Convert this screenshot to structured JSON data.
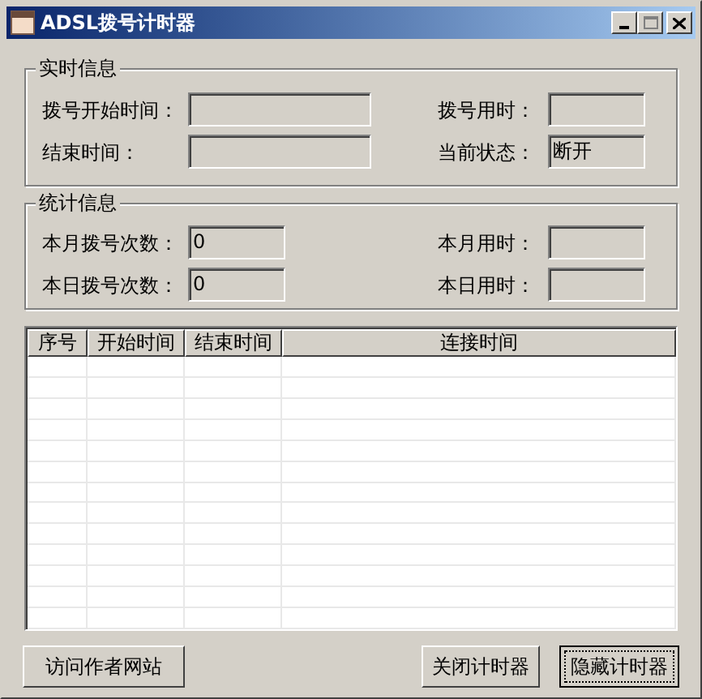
{
  "window": {
    "title": "ADSL拨号计时器"
  },
  "realtime": {
    "title": "实时信息",
    "rows": [
      {
        "left": {
          "label": "拨号开始时间："
        },
        "right": {
          "label": "拨号用时："
        }
      },
      {
        "left": {
          "label": "结束时间："
        },
        "right": {
          "label": "当前状态：",
          "value": "断开"
        }
      }
    ]
  },
  "stats": {
    "title": "统计信息",
    "rows": [
      {
        "left": {
          "label": "本月拨号次数：",
          "value": "0"
        },
        "right": {
          "label": "本月用时："
        }
      },
      {
        "left": {
          "label": "本日拨号次数：",
          "value": "0"
        },
        "right": {
          "label": "本日用时："
        }
      }
    ]
  },
  "table": {
    "columns": [
      "序号",
      "开始时间",
      "结束时间",
      "连接时间"
    ]
  },
  "buttons": [
    {
      "label": "访问作者网站",
      "default": false
    },
    {
      "label": "关闭计时器",
      "default": false
    },
    {
      "label": "隐藏计时器",
      "default": true
    }
  ]
}
